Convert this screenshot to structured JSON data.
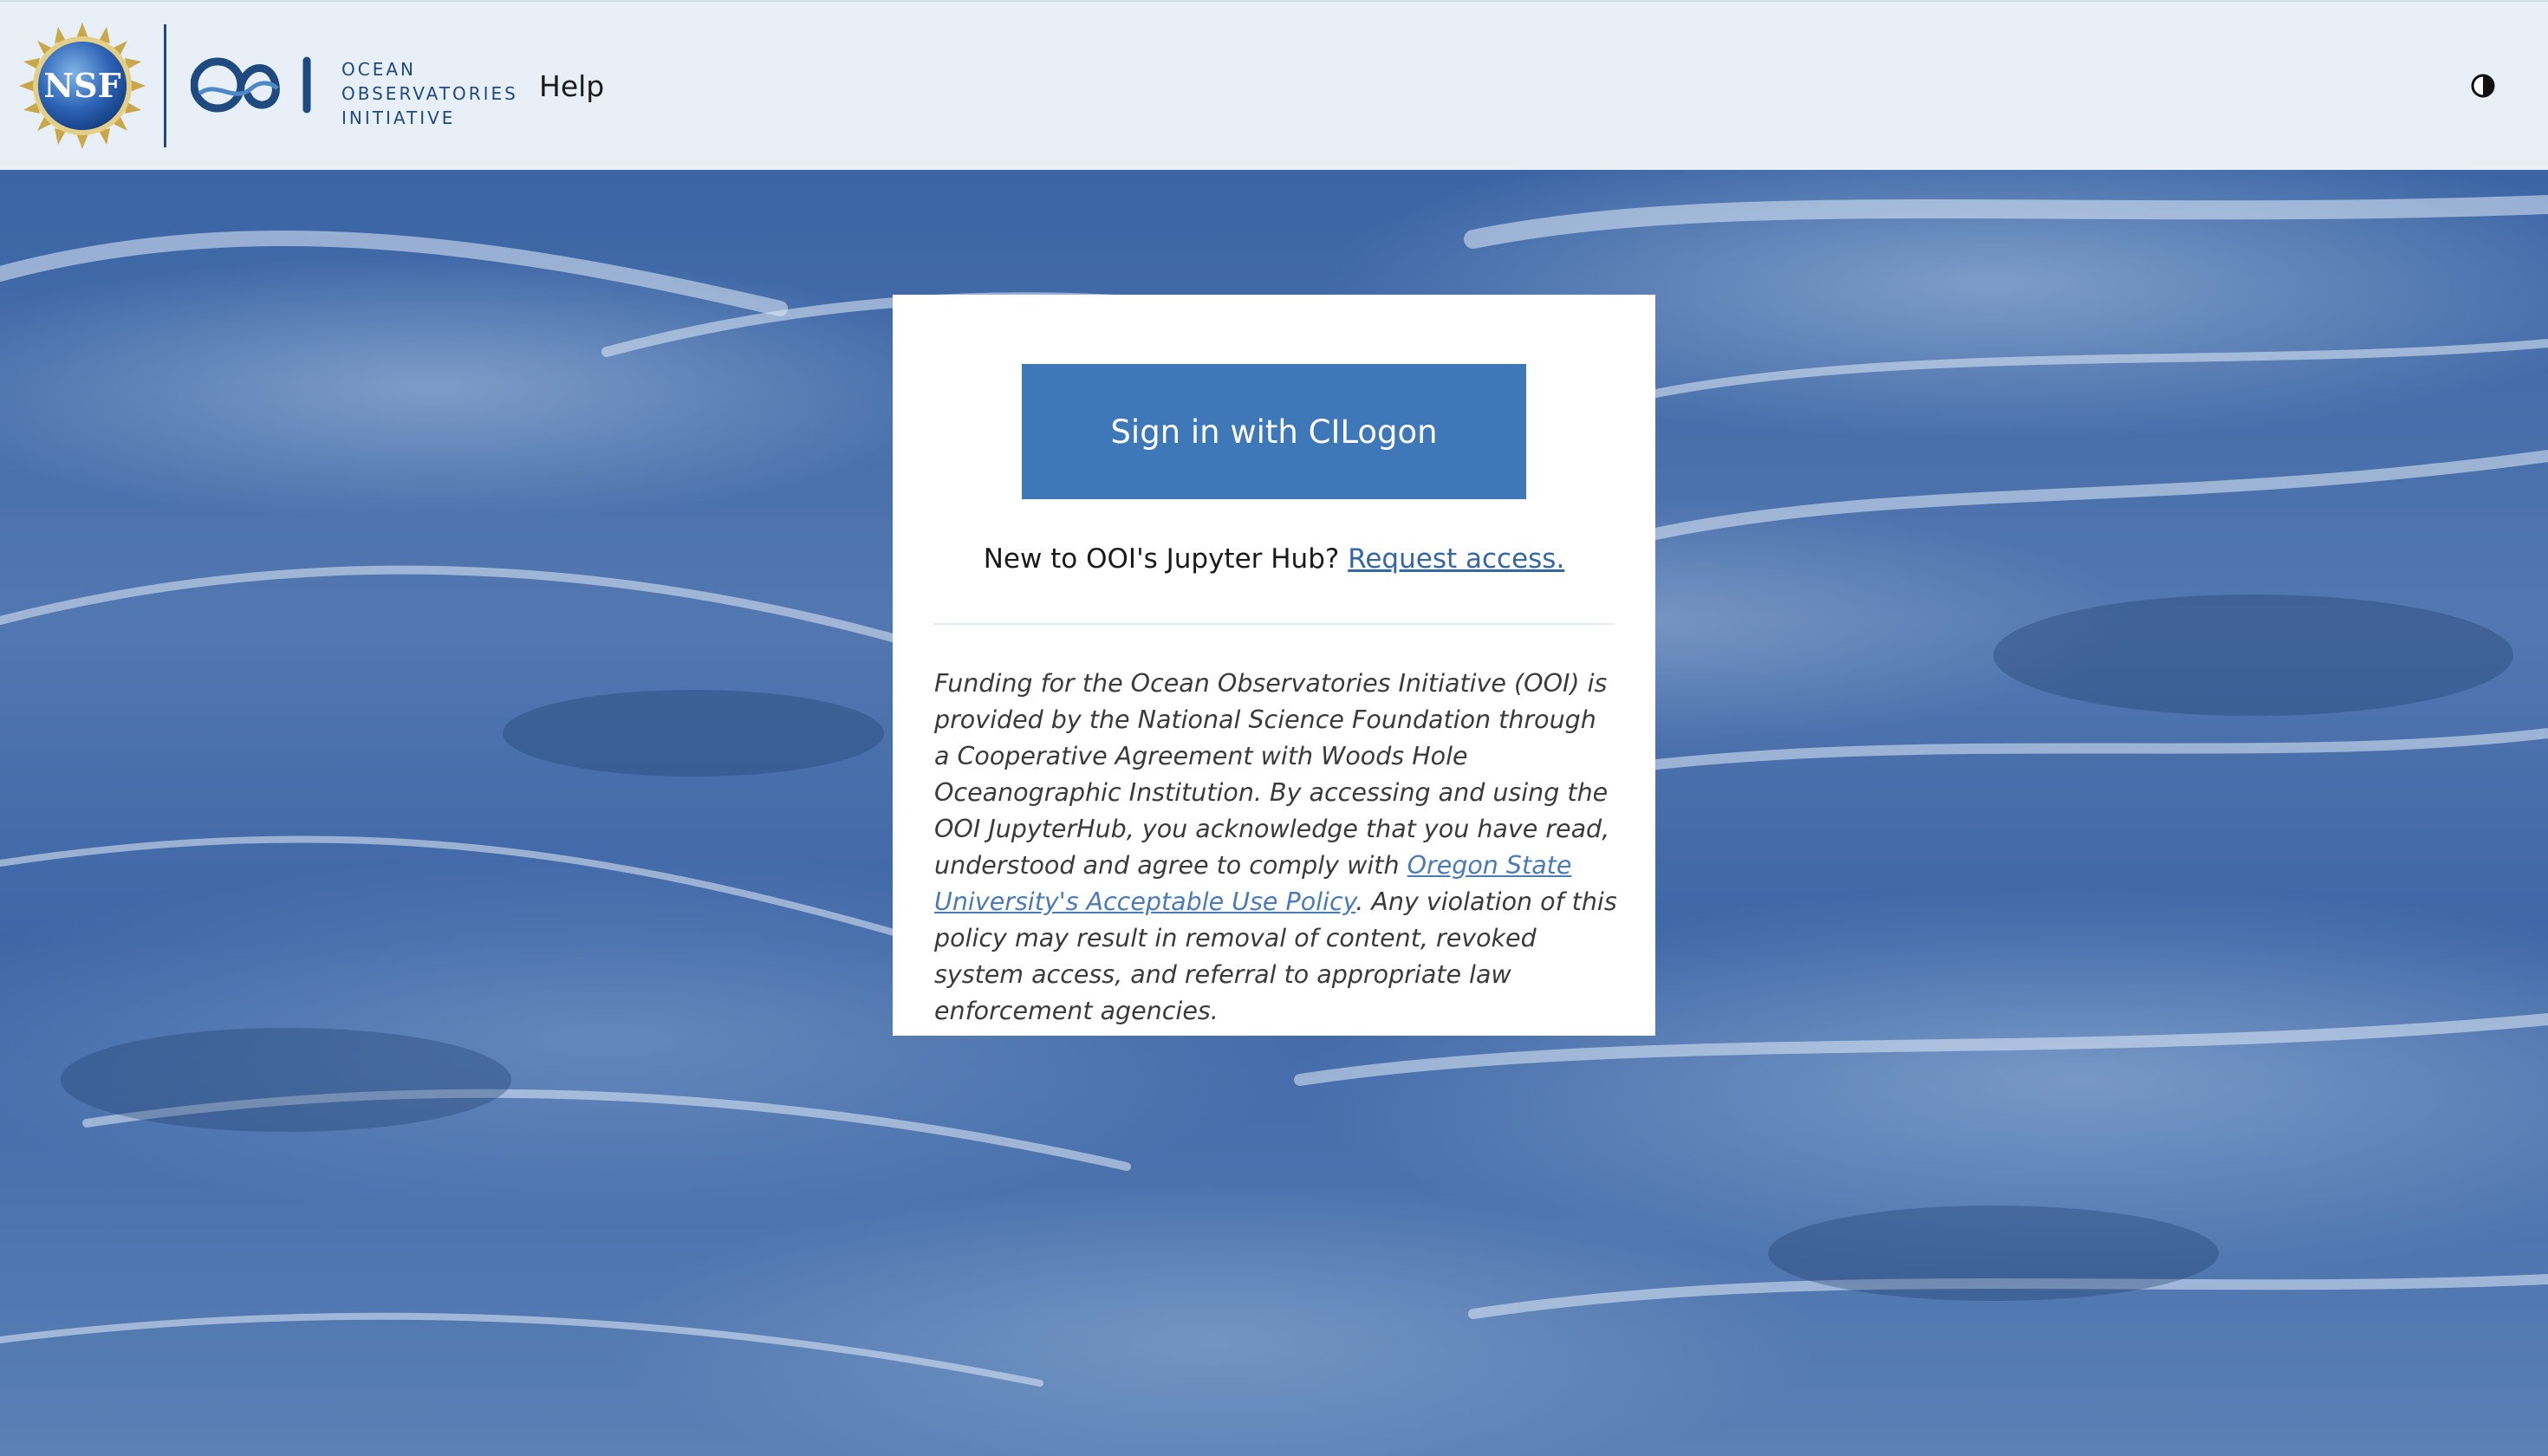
{
  "header": {
    "nsf_logo_text": "NSF",
    "ooi_logo_text": [
      "OCEAN",
      "OBSERVATORIES",
      "INITIATIVE"
    ],
    "help_label": "Help",
    "theme_toggle_icon": "contrast-icon"
  },
  "login": {
    "signin_label": "Sign in with CILogon",
    "new_user_text": "New to OOI's Jupyter Hub?",
    "request_access_label": "Request access.",
    "funding_text_before": "Funding for the Ocean Observatories Initiative (OOI) is provided by the National Science Foundation through a Cooperative Agreement with Woods Hole Oceanographic Institution. By accessing and using the OOI JupyterHub, you acknowledge that you have read, understood and agree to comply with ",
    "policy_link_label": "Oregon State University's Acceptable Use Policy",
    "funding_text_after": ". Any violation of this policy may result in removal of content, revoked system access, and referral to appropriate law enforcement agencies."
  },
  "colors": {
    "header_bg": "#e8eff7",
    "brand_blue": "#1f4a80",
    "button_blue": "#3e78b8",
    "link_blue": "#3566a8"
  }
}
